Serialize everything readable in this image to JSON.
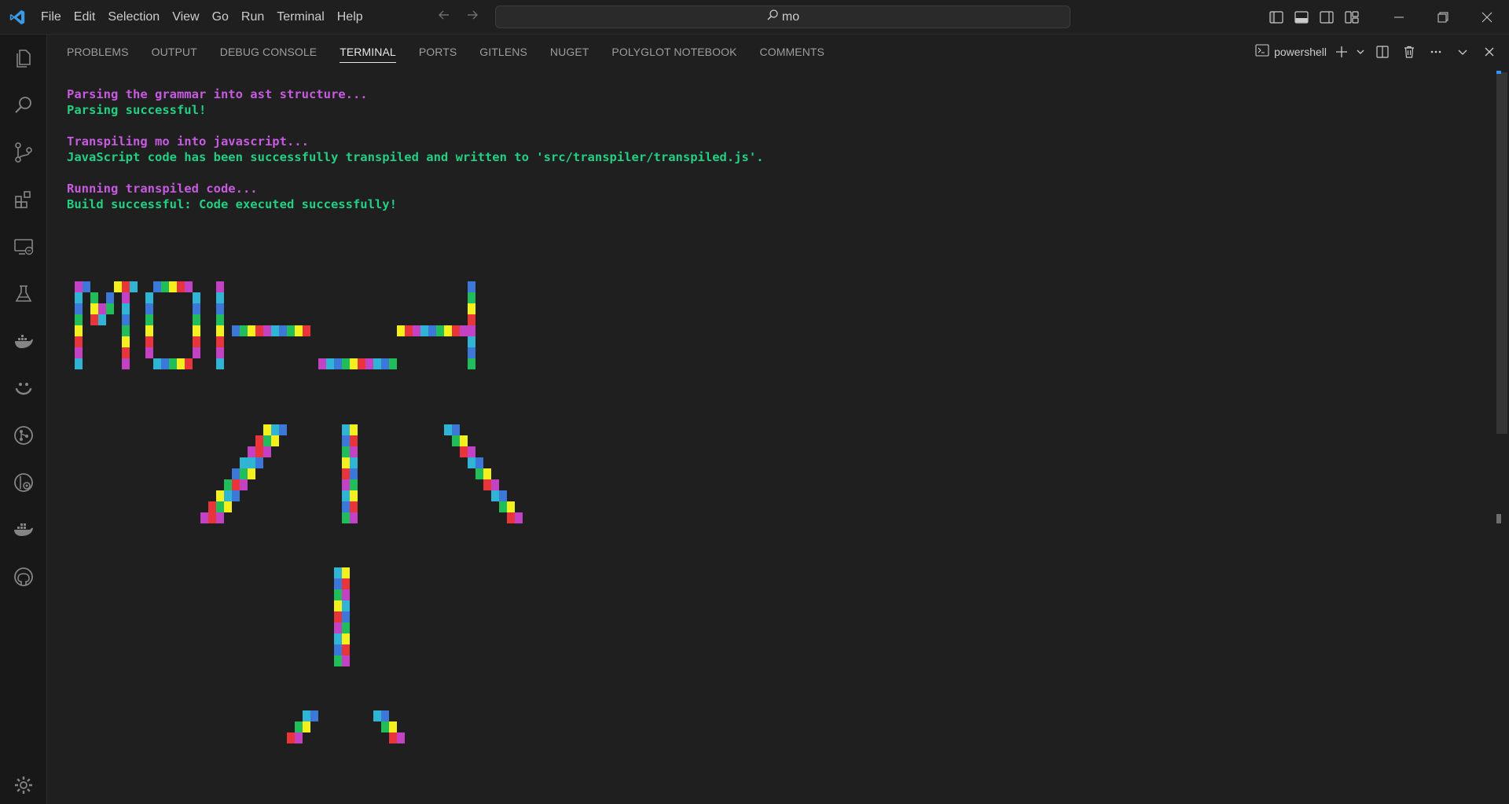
{
  "menu": [
    "File",
    "Edit",
    "Selection",
    "View",
    "Go",
    "Run",
    "Terminal",
    "Help"
  ],
  "command_center": {
    "text": "mo"
  },
  "panel": {
    "tabs": [
      {
        "label": "PROBLEMS",
        "active": false
      },
      {
        "label": "OUTPUT",
        "active": false
      },
      {
        "label": "DEBUG CONSOLE",
        "active": false
      },
      {
        "label": "TERMINAL",
        "active": true
      },
      {
        "label": "PORTS",
        "active": false
      },
      {
        "label": "GITLENS",
        "active": false
      },
      {
        "label": "NUGET",
        "active": false
      },
      {
        "label": "POLYGLOT NOTEBOOK",
        "active": false
      },
      {
        "label": "COMMENTS",
        "active": false
      }
    ],
    "shell": "powershell"
  },
  "terminal": {
    "lines": [
      {
        "text": "Parsing the grammar into ast structure...",
        "color": "#c65be0"
      },
      {
        "text": "Parsing successful!",
        "color": "#22cf83"
      },
      {
        "text": "",
        "color": ""
      },
      {
        "text": "Transpiling mo into javascript...",
        "color": "#c65be0"
      },
      {
        "text": "JavaScript code has been successfully transpiled and written to 'src/transpiler/transpiled.js'.",
        "color": "#22cf83"
      },
      {
        "text": "",
        "color": ""
      },
      {
        "text": "Running transpiled code...",
        "color": "#c65be0"
      },
      {
        "text": "Build successful: Code executed successfully!",
        "color": "#22cf83"
      }
    ],
    "art_palette": [
      "#c342c3",
      "#2fb4d3",
      "#3b78d8",
      "#22bd5b",
      "#f4f01e",
      "#e8353b"
    ]
  },
  "activity_icons": [
    "explorer-icon",
    "search-icon",
    "source-control-icon",
    "extensions-icon",
    "remote-explorer-icon",
    "testing-icon",
    "docker-whale-icon",
    "smile-icon",
    "git-graph-icon",
    "gitlens-icon",
    "docker-icon",
    "github-icon",
    "settings-gear-icon"
  ]
}
